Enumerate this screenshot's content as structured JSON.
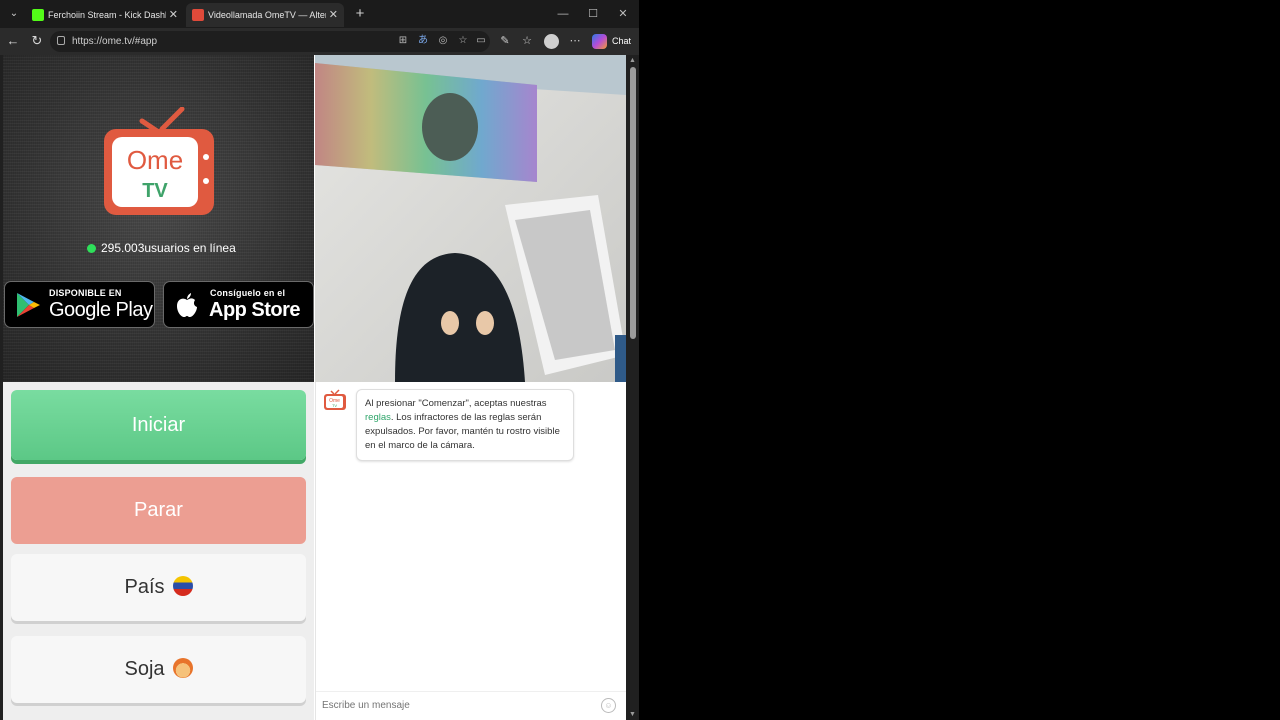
{
  "browser": {
    "tabs": [
      {
        "title": "Ferchoiin Stream - Kick Dashboard",
        "favicon_color": "#53fc18"
      },
      {
        "title": "Videollamada OmeTV — Alternativa",
        "favicon_color": "#e04a3a"
      }
    ],
    "new_tab": "+",
    "window_controls": {
      "minimize": "—",
      "maximize": "☐",
      "close": "✕"
    },
    "url": "https://ome.tv/#app",
    "chat_label": "Chat"
  },
  "hero": {
    "logo_line1": "Ome",
    "logo_line2": "TV",
    "online_text": "295.003usuarios en línea",
    "google_play": {
      "small": "DISPONIBLE EN",
      "big": "Google Play"
    },
    "app_store": {
      "small": "Consíguelo en el",
      "big": "App Store"
    }
  },
  "controls": {
    "start_label": "Iniciar",
    "stop_label": "Parar",
    "country_label": "País",
    "gender_label": "Soja"
  },
  "chat": {
    "logo_line1": "Ome",
    "logo_line2": "TV",
    "msg_before": "Al presionar \"Comenzar\", aceptas nuestras ",
    "msg_link": "reglas",
    "msg_after": ". Los infractores de las reglas serán expulsados. Por favor, mantén tu rostro visible en el marco de la cámara.",
    "placeholder": "Escribe un mensaje"
  },
  "colors": {
    "start": "#5cc886",
    "stop": "#ec9e92",
    "online_dot": "#2ee05a",
    "logo": "#e05a40",
    "link": "#2fa56a"
  }
}
